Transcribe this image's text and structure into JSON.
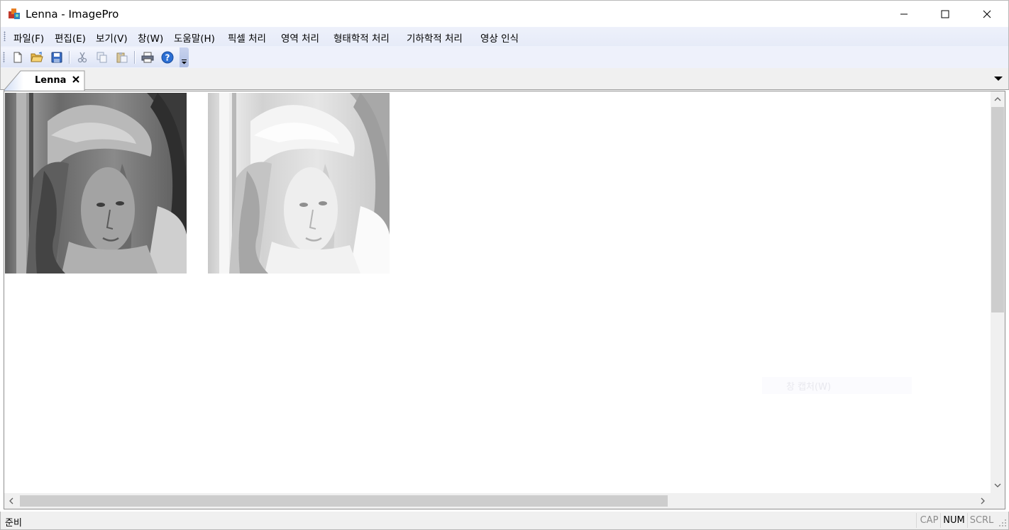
{
  "window": {
    "title": "Lenna - ImagePro"
  },
  "menu": {
    "items": [
      "파일(F)",
      "편집(E)",
      "보기(V)",
      "창(W)",
      "도움말(H)",
      "픽셀 처리",
      "영역 처리",
      "형태학적 처리",
      "기하학적 처리",
      "영상 인식"
    ]
  },
  "toolbar": {
    "buttons": [
      "new-icon",
      "open-icon",
      "save-icon",
      "cut-icon",
      "copy-icon",
      "paste-icon",
      "print-icon",
      "help-icon"
    ]
  },
  "tabs": {
    "active": "Lenna"
  },
  "overlay": {
    "ghost_menu_label": "창 캡처(W)"
  },
  "status": {
    "text": "준비",
    "indicators": [
      {
        "label": "CAP",
        "active": false
      },
      {
        "label": "NUM",
        "active": true
      },
      {
        "label": "SCRL",
        "active": false
      }
    ]
  },
  "colors": {
    "menubar": "#eef1fb",
    "tab_active": "#ffffff",
    "tab_accent": "#cfdcf5",
    "scroll_thumb": "#cdcdcd"
  }
}
